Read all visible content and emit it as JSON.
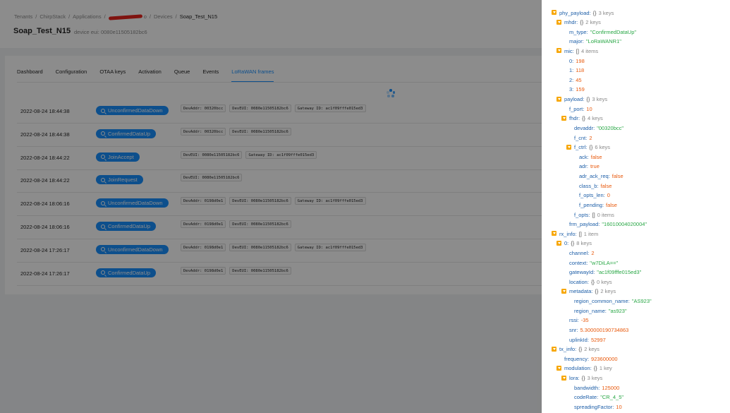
{
  "breadcrumb": {
    "tenants": "Tenants",
    "chirpstack": "ChirpStack",
    "applications": "Applications",
    "redacted_suffix": "o",
    "devices": "Devices",
    "device": "Soap_Test_N15",
    "separator": "/"
  },
  "page": {
    "title": "Soap_Test_N15",
    "subtitle": "device eui: 0080e11505182bc6"
  },
  "tabs": [
    "Dashboard",
    "Configuration",
    "OTAA keys",
    "Activation",
    "Queue",
    "Events",
    "LoRaWAN frames"
  ],
  "active_tab": "LoRaWAN frames",
  "frames": [
    {
      "time": "2022-08-24 18:44:38",
      "type": "UnconfirmedDataDown",
      "tags": [
        "DevAddr: 00320bcc",
        "DevEUI: 0080e11505182bc6",
        "Gateway ID: ac1f09fffe015ed3"
      ]
    },
    {
      "time": "2022-08-24 18:44:38",
      "type": "ConfirmedDataUp",
      "tags": [
        "DevAddr: 00320bcc",
        "DevEUI: 0080e11505182bc6"
      ]
    },
    {
      "time": "2022-08-24 18:44:22",
      "type": "JoinAccept",
      "tags": [
        "DevEUI: 0080e11505182bc6",
        "Gateway ID: ac1f09fffe015ed3"
      ]
    },
    {
      "time": "2022-08-24 18:44:22",
      "type": "JoinRequest",
      "tags": [
        "DevEUI: 0080e11505182bc6"
      ]
    },
    {
      "time": "2022-08-24 18:06:16",
      "type": "UnconfirmedDataDown",
      "tags": [
        "DevAddr: 0198d0e1",
        "DevEUI: 0080e11505182bc6",
        "Gateway ID: ac1f09fffe015ed3"
      ]
    },
    {
      "time": "2022-08-24 18:06:16",
      "type": "ConfirmedDataUp",
      "tags": [
        "DevAddr: 0198d0e1",
        "DevEUI: 0080e11505182bc6"
      ]
    },
    {
      "time": "2022-08-24 17:26:17",
      "type": "UnconfirmedDataDown",
      "tags": [
        "DevAddr: 0198d0e1",
        "DevEUI: 0080e11505182bc6",
        "Gateway ID: ac1f09fffe015ed3"
      ]
    },
    {
      "time": "2022-08-24 17:26:17",
      "type": "ConfirmedDataUp",
      "tags": [
        "DevAddr: 0198d0e1",
        "DevEUI: 0080e11505182bc6"
      ]
    }
  ],
  "colors": {
    "accent": "#1890ff",
    "caret": "#f7a707",
    "string": "#28a745",
    "number": "#e8590c"
  },
  "json_tree": [
    {
      "depth": 0,
      "key": "phy_payload",
      "kind": "object",
      "meta": "3 keys",
      "expandable": true
    },
    {
      "depth": 1,
      "key": "mhdr",
      "kind": "object",
      "meta": "2 keys",
      "expandable": true
    },
    {
      "depth": 2,
      "key": "m_type",
      "kind": "string",
      "value": "\"ConfirmedDataUp\""
    },
    {
      "depth": 2,
      "key": "major",
      "kind": "string",
      "value": "\"LoRaWANR1\""
    },
    {
      "depth": 1,
      "key": "mic",
      "kind": "array",
      "meta": "4 items",
      "expandable": true
    },
    {
      "depth": 2,
      "key": "0",
      "kind": "number",
      "value": "198"
    },
    {
      "depth": 2,
      "key": "1",
      "kind": "number",
      "value": "118"
    },
    {
      "depth": 2,
      "key": "2",
      "kind": "number",
      "value": "45"
    },
    {
      "depth": 2,
      "key": "3",
      "kind": "number",
      "value": "159"
    },
    {
      "depth": 1,
      "key": "payload",
      "kind": "object",
      "meta": "3 keys",
      "expandable": true
    },
    {
      "depth": 2,
      "key": "f_port",
      "kind": "number",
      "value": "10"
    },
    {
      "depth": 2,
      "key": "fhdr",
      "kind": "object",
      "meta": "4 keys",
      "expandable": true
    },
    {
      "depth": 3,
      "key": "devaddr",
      "kind": "string",
      "value": "\"00320bcc\""
    },
    {
      "depth": 3,
      "key": "f_cnt",
      "kind": "number",
      "value": "2"
    },
    {
      "depth": 3,
      "key": "f_ctrl",
      "kind": "object",
      "meta": "6 keys",
      "expandable": true
    },
    {
      "depth": 4,
      "key": "ack",
      "kind": "bool",
      "value": "false"
    },
    {
      "depth": 4,
      "key": "adr",
      "kind": "bool",
      "value": "true"
    },
    {
      "depth": 4,
      "key": "adr_ack_req",
      "kind": "bool",
      "value": "false"
    },
    {
      "depth": 4,
      "key": "class_b",
      "kind": "bool",
      "value": "false"
    },
    {
      "depth": 4,
      "key": "f_opts_len",
      "kind": "number",
      "value": "0"
    },
    {
      "depth": 4,
      "key": "f_pending",
      "kind": "bool",
      "value": "false"
    },
    {
      "depth": 3,
      "key": "f_opts",
      "kind": "array",
      "meta": "0 items",
      "expandable": false
    },
    {
      "depth": 2,
      "key": "frm_payload",
      "kind": "string",
      "value": "\"16010004020004\""
    },
    {
      "depth": 0,
      "key": "rx_info",
      "kind": "array",
      "meta": "1 item",
      "expandable": true
    },
    {
      "depth": 1,
      "key": "0",
      "kind": "object",
      "meta": "8 keys",
      "expandable": true
    },
    {
      "depth": 2,
      "key": "channel",
      "kind": "number",
      "value": "2"
    },
    {
      "depth": 2,
      "key": "context",
      "kind": "string",
      "value": "\"w7DiLA==\""
    },
    {
      "depth": 2,
      "key": "gatewayId",
      "kind": "string",
      "value": "\"ac1f09fffe015ed3\""
    },
    {
      "depth": 2,
      "key": "location",
      "kind": "object",
      "meta": "0 keys",
      "expandable": false
    },
    {
      "depth": 2,
      "key": "metadata",
      "kind": "object",
      "meta": "2 keys",
      "expandable": true
    },
    {
      "depth": 3,
      "key": "region_common_name",
      "kind": "string",
      "value": "\"AS923\""
    },
    {
      "depth": 3,
      "key": "region_name",
      "kind": "string",
      "value": "\"as923\""
    },
    {
      "depth": 2,
      "key": "rssi",
      "kind": "number",
      "value": "-35"
    },
    {
      "depth": 2,
      "key": "snr",
      "kind": "number",
      "value": "5.300000190734863"
    },
    {
      "depth": 2,
      "key": "uplinkId",
      "kind": "number",
      "value": "52997"
    },
    {
      "depth": 0,
      "key": "tx_info",
      "kind": "object",
      "meta": "2 keys",
      "expandable": true
    },
    {
      "depth": 1,
      "key": "frequency",
      "kind": "number",
      "value": "923600000"
    },
    {
      "depth": 1,
      "key": "modulation",
      "kind": "object",
      "meta": "1 key",
      "expandable": true
    },
    {
      "depth": 2,
      "key": "lora",
      "kind": "object",
      "meta": "3 keys",
      "expandable": true
    },
    {
      "depth": 3,
      "key": "bandwidth",
      "kind": "number",
      "value": "125000"
    },
    {
      "depth": 3,
      "key": "codeRate",
      "kind": "string",
      "value": "\"CR_4_5\""
    },
    {
      "depth": 3,
      "key": "spreadingFactor",
      "kind": "number",
      "value": "10"
    }
  ]
}
